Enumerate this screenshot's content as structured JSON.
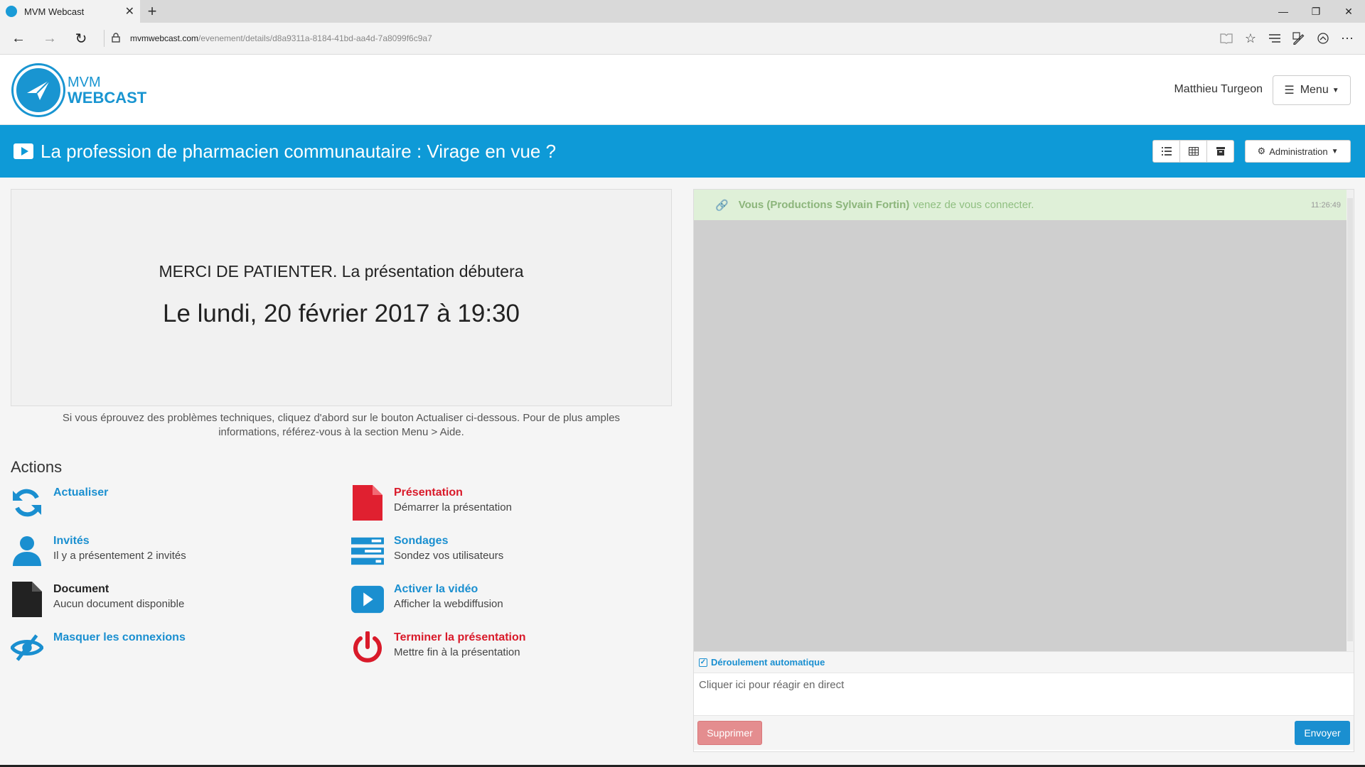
{
  "browser": {
    "tab_title": "MVM Webcast",
    "tab_close": "✕",
    "new_tab": "+",
    "url_host": "mvmwebcast.com",
    "url_path": "/evenement/details/d8a9311a-8184-41bd-aa4d-7a8099f6c9a7",
    "window_controls": [
      "—",
      "❐",
      "✕"
    ],
    "nav": {
      "back": "←",
      "forward": "→",
      "refresh": "↻"
    },
    "toolbar_icons": [
      "reading-view-icon",
      "favorite-star-icon",
      "hub-icon",
      "web-note-icon",
      "share-icon",
      "more-icon"
    ]
  },
  "header": {
    "logo_line1": "MVM",
    "logo_line2": "WEBCAST",
    "user_name": "Matthieu Turgeon",
    "menu_label": "Menu"
  },
  "titlebar": {
    "title": "La profession de pharmacien communautaire : Virage en vue ?",
    "admin_label": "Administration"
  },
  "waiting": {
    "line1": "MERCI DE PATIENTER. La présentation débutera",
    "line2": "Le lundi, 20 février 2017 à 19:30"
  },
  "help_text": "Si vous éprouvez des problèmes techniques, cliquez d'abord sur le bouton Actualiser ci-dessous. Pour de plus amples informations, référez-vous à la section Menu > Aide.",
  "actions": {
    "title": "Actions",
    "refresh": {
      "title": "Actualiser",
      "desc": ""
    },
    "guests": {
      "title": "Invités",
      "desc": "Il y a présentement 2 invités"
    },
    "document": {
      "title": "Document",
      "desc": "Aucun document disponible"
    },
    "hide_connections": {
      "title": "Masquer les connexions",
      "desc": ""
    },
    "presentation": {
      "title": "Présentation",
      "desc": "Démarrer la présentation"
    },
    "polls": {
      "title": "Sondages",
      "desc": "Sondez vos utilisateurs"
    },
    "video": {
      "title": "Activer la vidéo",
      "desc": "Afficher la webdiffusion"
    },
    "end": {
      "title": "Terminer la présentation",
      "desc": "Mettre fin à la présentation"
    }
  },
  "chat": {
    "message_user": "Vous (Productions Sylvain Fortin)",
    "message_text": "venez de vous connecter.",
    "message_time": "11:26:49",
    "autoscroll_label": "Déroulement automatique",
    "input_placeholder": "Cliquer ici pour réagir en direct",
    "delete_label": "Supprimer",
    "send_label": "Envoyer"
  },
  "colors": {
    "brand_blue": "#0e9ad7",
    "action_blue": "#1a8fd0",
    "action_red": "#d91a2a",
    "chat_success_bg": "#dff0d8"
  }
}
